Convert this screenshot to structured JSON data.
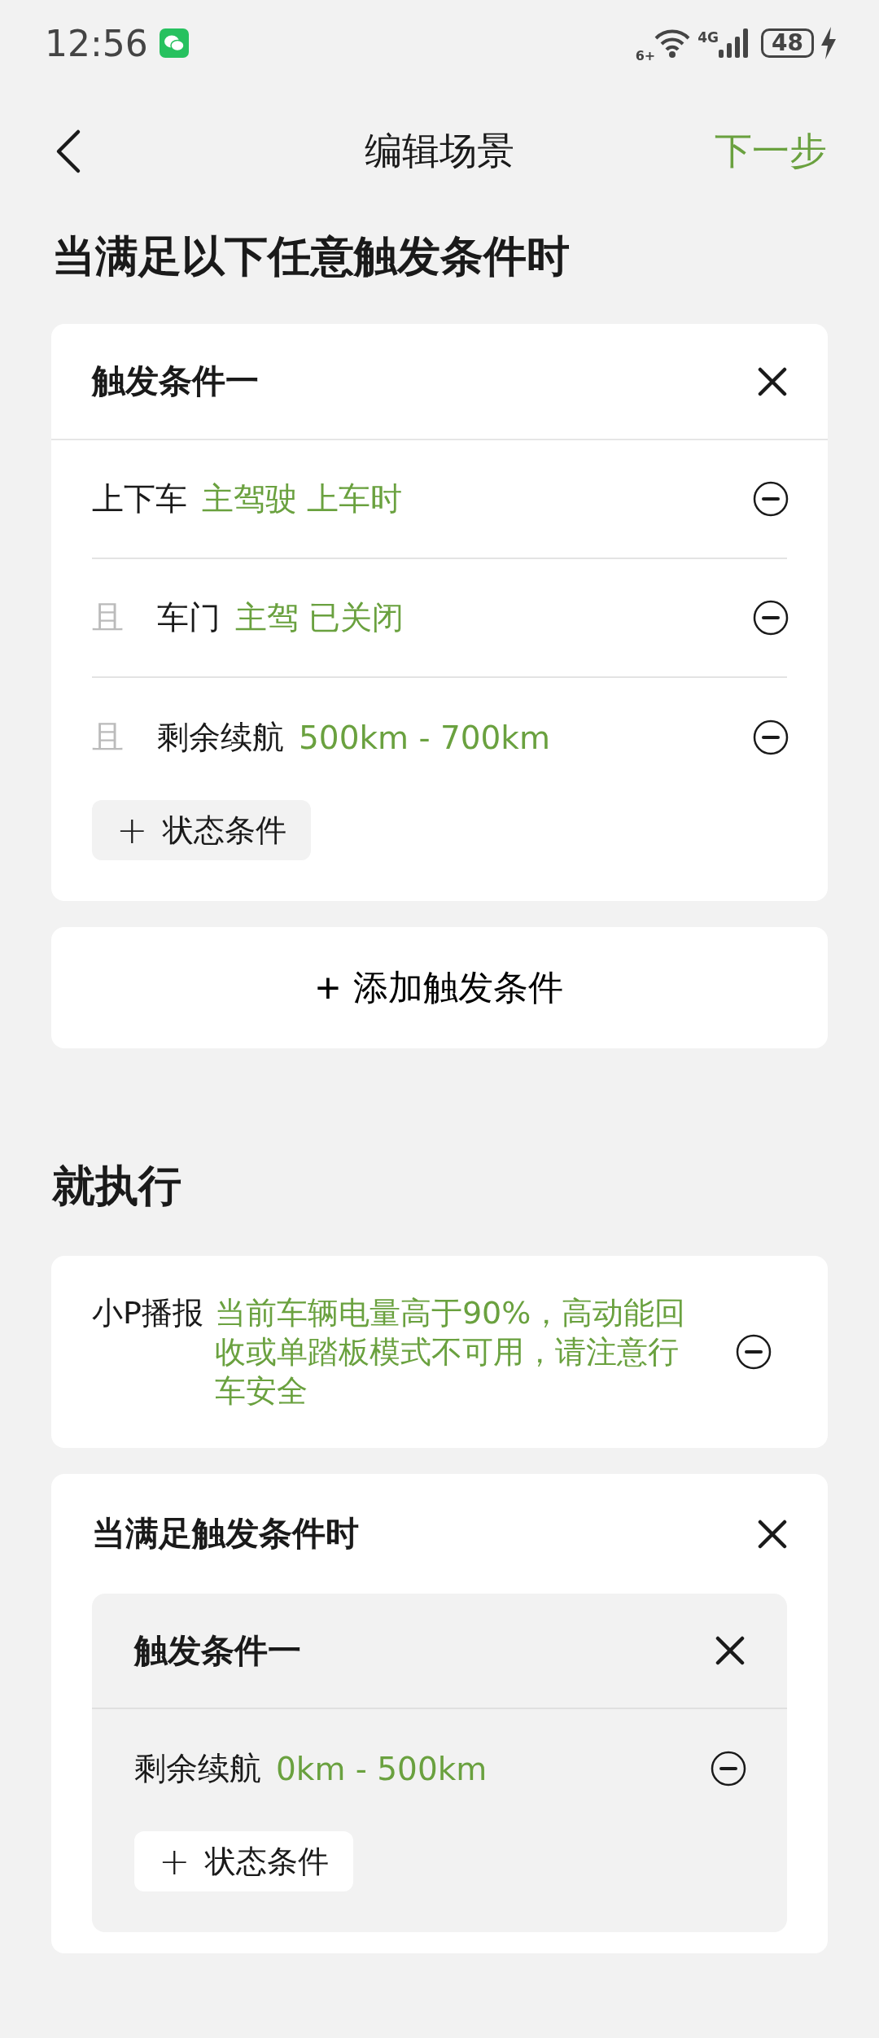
{
  "status_bar": {
    "time": "12:56",
    "wifi_label": "6+",
    "network": "4G",
    "battery": "48"
  },
  "nav": {
    "title": "编辑场景",
    "next": "下一步"
  },
  "trigger_section": {
    "heading": "当满足以下任意触发条件时",
    "triggers": [
      {
        "title": "触发条件一",
        "add_label": "状态条件",
        "add_icon": "+",
        "conditions": [
          {
            "label": "上下车",
            "value": "主驾驶 上车时"
          },
          {
            "conjunction": "且",
            "label": "车门",
            "value": "主驾 已关闭"
          },
          {
            "conjunction": "且",
            "label": "剩余续航",
            "value": "500km - 700km"
          }
        ]
      }
    ],
    "add_trigger": {
      "icon": "+",
      "label": "添加触发条件"
    }
  },
  "action_section": {
    "heading": "就执行",
    "actions": [
      {
        "kind": "speech",
        "label": "小P播报",
        "value": "当前车辆电量高于90%，高动能回收或单踏板模式不可用，请注意行车安全"
      },
      {
        "kind": "conditional",
        "title": "当满足触发条件时",
        "triggers": [
          {
            "title": "触发条件一",
            "add_label": "状态条件",
            "add_icon": "+",
            "conditions": [
              {
                "label": "剩余续航",
                "value": "0km - 500km"
              }
            ]
          }
        ]
      }
    ]
  }
}
